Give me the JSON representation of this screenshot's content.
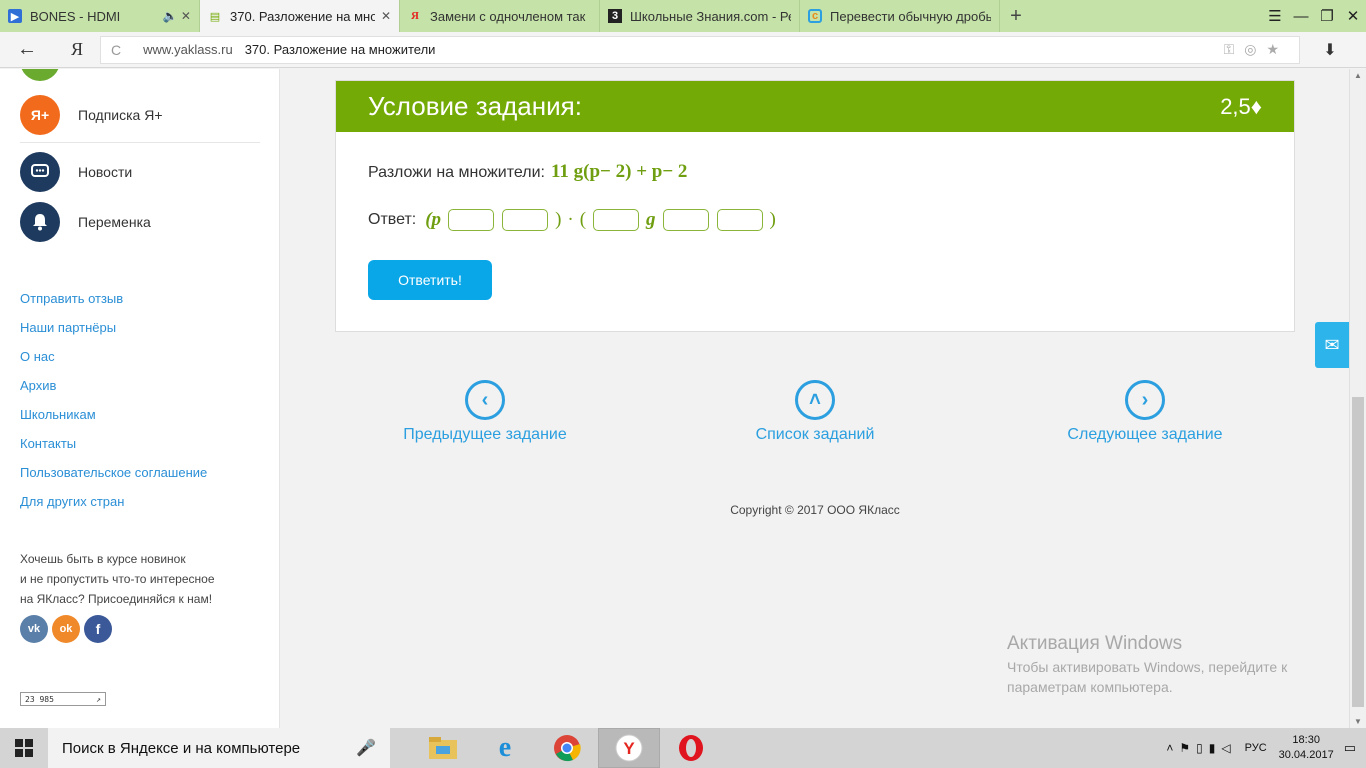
{
  "browser": {
    "tabs": [
      {
        "title": "BONES - HDMI",
        "extra": "🔈 ✕",
        "icon": "play-icon",
        "active": false
      },
      {
        "title": "370. Разложение на мно",
        "extra": "✕",
        "icon": "book-icon",
        "active": true
      },
      {
        "title": "Замени с одночленом так",
        "extra": "",
        "icon": "yandex-icon",
        "active": false
      },
      {
        "title": "Школьные Знания.com - Ре",
        "extra": "",
        "icon": "znanija-icon",
        "active": false
      },
      {
        "title": "Перевести обычную дробь",
        "extra": "",
        "icon": "site-icon",
        "active": false
      }
    ],
    "new_tab": "+",
    "window_controls": [
      "☰",
      "—",
      "❐",
      "✕"
    ],
    "back": "←",
    "yandex": "Я",
    "reload": "C",
    "domain": "www.yaklass.ru",
    "page_title": "370. Разложение на множители",
    "download": "⬇"
  },
  "sidebar": {
    "items": [
      {
        "label": "Подписка Я+",
        "badge": "Я+",
        "color": "#f26b1d"
      },
      {
        "label": "Новости",
        "badge": "▭",
        "color": "#1e3a5f"
      },
      {
        "label": "Переменка",
        "badge": "🔔",
        "color": "#1e3a5f"
      }
    ],
    "links": [
      "Отправить отзыв",
      "Наши партнёры",
      "О нас",
      "Архив",
      "Школьникам",
      "Контакты",
      "Пользовательское соглашение",
      "Для других стран"
    ],
    "promo": [
      "Хочешь быть в курсе новинок",
      "и не пропустить что-то интересное",
      "на ЯКласс? Присоединяйся к нам!"
    ],
    "social": [
      {
        "label": "vk",
        "color": "#5a7fa8"
      },
      {
        "label": "ok",
        "color": "#f0892a"
      },
      {
        "label": "f",
        "color": "#3b5998"
      }
    ],
    "counter": "23 985",
    "counter_arrow": "↗"
  },
  "task": {
    "title": "Условие задания:",
    "points": "2,5♦",
    "question_label": "Разложи на множители:",
    "expression": "11 g(p− 2) + p− 2",
    "answer_label": "Ответ:",
    "answer_parts": {
      "open1": "(p",
      "close1": ")",
      "dot": "·",
      "open2": "(",
      "g": "g",
      "close2": ")"
    },
    "submit": "Ответить!"
  },
  "navigation": {
    "prev": {
      "label": "Предыдущее задание",
      "icon": "‹"
    },
    "list": {
      "label": "Список заданий",
      "icon": "˄"
    },
    "next": {
      "label": "Следующее задание",
      "icon": "›"
    }
  },
  "footer": {
    "copyright": "Copyright © 2017 ООО ЯКласс"
  },
  "activation": {
    "title": "Активация Windows",
    "line1": "Чтобы активировать Windows, перейдите к",
    "line2": "параметрам компьютера."
  },
  "taskbar": {
    "search_placeholder": "Поиск в Яндексе и на компьютере",
    "apps": [
      "file-explorer-icon",
      "internet-explorer-icon",
      "chrome-icon",
      "yandex-browser-icon",
      "opera-icon"
    ],
    "lang": "РУС",
    "time": "18:30",
    "date": "30.04.2017"
  },
  "colors": {
    "accent_green": "#74aa06",
    "link_blue": "#2b9fdf",
    "button_blue": "#0aa7e8"
  }
}
